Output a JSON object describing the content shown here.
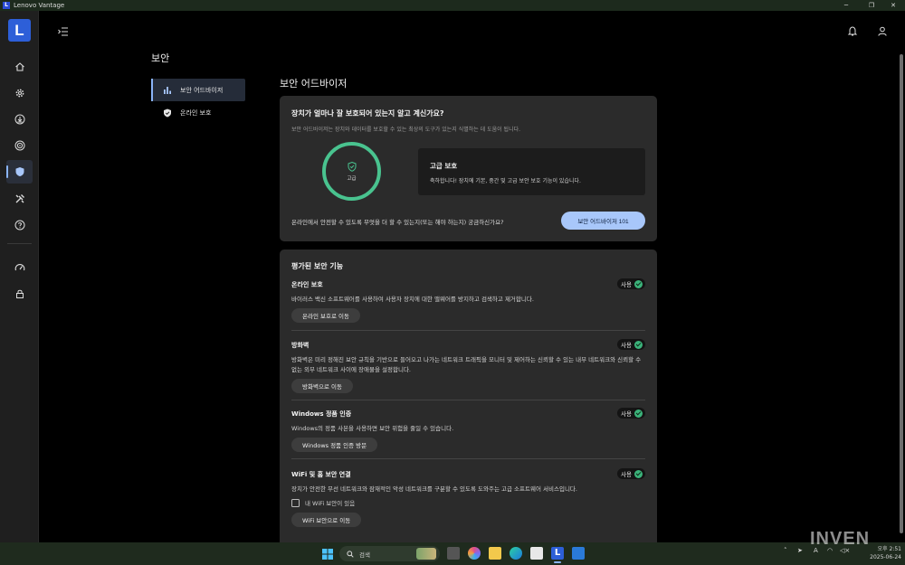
{
  "window": {
    "title": "Lenovo Vantage",
    "app_letter": "L"
  },
  "page": {
    "title": "보안"
  },
  "subnav": {
    "items": [
      {
        "label": "보안 어드바이저",
        "active": true
      },
      {
        "label": "온라인 보호",
        "active": false
      }
    ]
  },
  "main": {
    "title": "보안 어드바이저",
    "advisor": {
      "question": "장치가 얼마나 잘 보호되어 있는지 알고 계신가요?",
      "description": "보안 어드바이저는 장치와 데이터를 보호할 수 있는 최상의 도구가 있는지 식별하는 데 도움이 됩니다.",
      "ring_label": "고급",
      "level_title": "고급 보호",
      "level_desc": "축하합니다! 장치에 기본, 중간 및 고급 보안 보호 기능이 있습니다.",
      "ask": "온라인에서 안전할 수 있도록 무엇을 더 할 수 있는지(또는 해야 하는지) 궁금하신가요?",
      "cta": "보안 어드바이저 101"
    },
    "features": {
      "title": "평가된 보안 기능",
      "status_label": "사용",
      "items": [
        {
          "name": "온라인 보호",
          "desc": "바이러스 백신 소프트웨어를 사용하여 사용자 장치에 대한 맬웨어를 방지하고 검색하고 제거합니다.",
          "button": "온라인 보호로 이동"
        },
        {
          "name": "방화벽",
          "desc": "방화벽은 미리 정해진 보안 규칙을 기반으로 들어오고 나가는 네트워크 트래픽을 모니터 및 제어하는 신뢰할 수 있는 내부 네트워크와 신뢰할 수 없는 외부 네트워크 사이에 장애물을 설정합니다.",
          "button": "방화벽으로 이동"
        },
        {
          "name": "Windows 정품 인증",
          "desc": "Windows의 정품 사본을 사용하면 보안 위험을 줄일 수 있습니다.",
          "button": "Windows 정품 인증 방문"
        },
        {
          "name": "WiFi 및 홈 보안 연결",
          "desc": "장치가 안전한 무선 네트워크와 잠재적인 악성 네트워크를 구분할 수 있도록 도와주는 고급 소프트웨어 서비스입니다.",
          "checkbox": "내 WiFi 보안이 있음",
          "button": "WiFi 보안으로 이동"
        }
      ]
    }
  },
  "taskbar": {
    "search_placeholder": "검색",
    "clock_time": "오후 2:51",
    "clock_date": "2025-06-24",
    "ime": "A"
  },
  "watermark": "INVEN",
  "colors": {
    "accent": "#8ab4f8",
    "primary_button": "#a8c7fa",
    "success": "#49c38f",
    "brand": "#2d5fd8"
  }
}
